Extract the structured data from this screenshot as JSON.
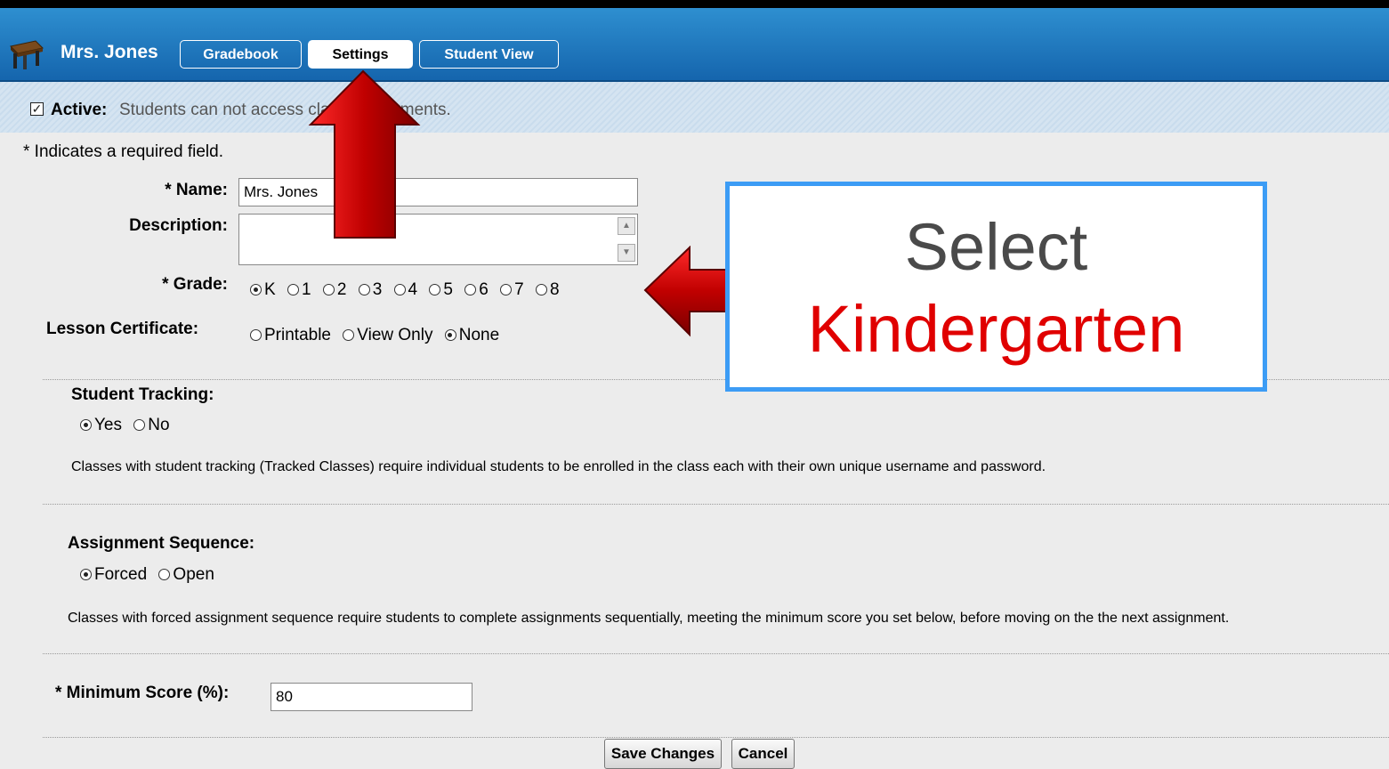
{
  "header": {
    "class_name": "Mrs. Jones",
    "tabs": [
      {
        "label": "Gradebook",
        "active": false
      },
      {
        "label": "Settings",
        "active": true
      },
      {
        "label": "Student View",
        "active": false
      }
    ]
  },
  "active_bar": {
    "label": "Active:",
    "text": "Students can not access class assignments.",
    "checked": true
  },
  "form": {
    "required_note": "* Indicates a required field.",
    "name_label": "* Name:",
    "name_value": "Mrs. Jones",
    "description_label": "Description:",
    "description_value": "",
    "grade_label": "* Grade:",
    "grade_options": [
      "K",
      "1",
      "2",
      "3",
      "4",
      "5",
      "6",
      "7",
      "8"
    ],
    "grade_selected": "K",
    "certificate_label": "Lesson Certificate:",
    "certificate_options": [
      "Printable",
      "View Only",
      "None"
    ],
    "certificate_selected": "None"
  },
  "tracking": {
    "title": "Student Tracking:",
    "options": [
      "Yes",
      "No"
    ],
    "selected": "Yes",
    "description": "Classes with student tracking (Tracked Classes) require individual students to be enrolled in the class each with their own unique username and password."
  },
  "sequence": {
    "title": "Assignment Sequence:",
    "options": [
      "Forced",
      "Open"
    ],
    "selected": "Forced",
    "description": "Classes with forced assignment sequence require students to complete assignments sequentially, meeting the minimum score you set below, before moving on the the next assignment."
  },
  "minimum_score": {
    "label": "* Minimum Score (%):",
    "value": "80"
  },
  "buttons": {
    "save": "Save Changes",
    "cancel": "Cancel"
  },
  "callout": {
    "line1": "Select",
    "line2": "Kindergarten"
  },
  "colors": {
    "header_blue": "#1a74bd",
    "callout_border": "#3c9cf5",
    "callout_highlight": "#e00000",
    "arrow_red": "#c00000"
  }
}
